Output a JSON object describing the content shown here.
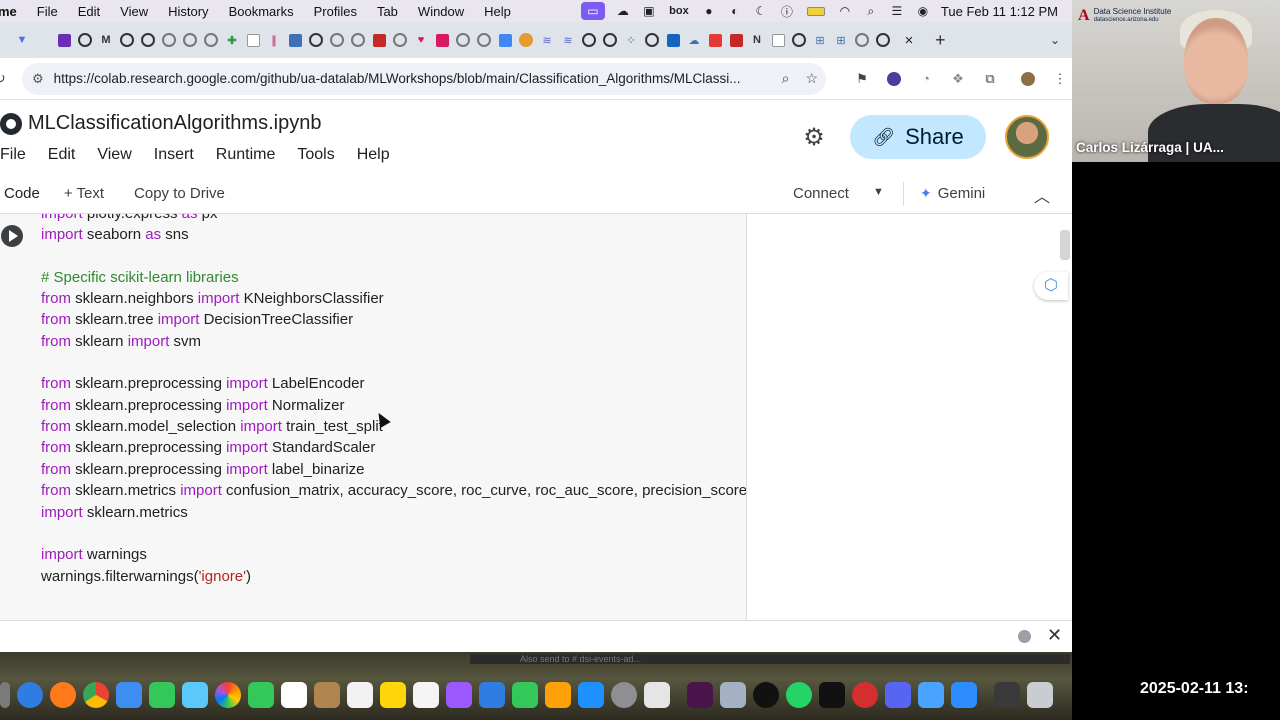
{
  "menubar": {
    "items": [
      "me",
      "File",
      "Edit",
      "View",
      "History",
      "Bookmarks",
      "Profiles",
      "Tab",
      "Window",
      "Help"
    ],
    "clock": "Tue Feb 11  1:12 PM"
  },
  "tabs": {
    "close": "×",
    "new": "+",
    "menu": "⌄"
  },
  "address": {
    "url": "https://colab.research.google.com/github/ua-datalab/MLWorkshops/blob/main/Classification_Algorithms/MLClassi..."
  },
  "colab": {
    "title": "MLClassificationAlgorithms.ipynb",
    "menu": [
      "File",
      "Edit",
      "View",
      "Insert",
      "Runtime",
      "Tools",
      "Help"
    ],
    "share_label": "Share"
  },
  "toolbar": {
    "code": "Code",
    "text": "+ Text",
    "copy": "Copy to Drive",
    "connect": "Connect",
    "gemini": "Gemini"
  },
  "code_lines": [
    {
      "kw1": "import",
      "mid": " plotly.express ",
      "kw2": "as",
      "tail": " px"
    },
    {
      "kw1": "import",
      "mid": " seaborn ",
      "kw2": "as",
      "tail": " sns"
    },
    {
      "comment": "# Specific scikit-learn libraries"
    },
    {
      "kw1": "from",
      "mid": " sklearn.neighbors ",
      "kw2": "import",
      "tail": " KNeighborsClassifier"
    },
    {
      "kw1": "from",
      "mid": " sklearn.tree ",
      "kw2": "import",
      "tail": " DecisionTreeClassifier"
    },
    {
      "kw1": "from",
      "mid": " sklearn ",
      "kw2": "import",
      "tail": " svm"
    },
    {
      "kw1": "from",
      "mid": " sklearn.preprocessing ",
      "kw2": "import",
      "tail": " LabelEncoder"
    },
    {
      "kw1": "from",
      "mid": " sklearn.preprocessing ",
      "kw2": "import",
      "tail": " Normalizer"
    },
    {
      "kw1": "from",
      "mid": " sklearn.model_selection ",
      "kw2": "import",
      "tail": " train_test_split"
    },
    {
      "kw1": "from",
      "mid": " sklearn.preprocessing ",
      "kw2": "import",
      "tail": " StandardScaler"
    },
    {
      "kw1": "from",
      "mid": " sklearn.preprocessing ",
      "kw2": "import",
      "tail": " label_binarize"
    },
    {
      "kw1": "from",
      "mid": " sklearn.metrics ",
      "kw2": "import",
      "tail": " confusion_matrix, accuracy_score, roc_curve, roc_auc_score, precision_score"
    },
    {
      "kw1": "import",
      "mid": " sklearn.metrics",
      "kw2": "",
      "tail": ""
    },
    {
      "kw1": "import",
      "mid": " warnings",
      "kw2": "",
      "tail": ""
    },
    {
      "plain": "warnings.filterwarnings(",
      "string": "'ignore'",
      "close": ")"
    }
  ],
  "dock_strip_text": "Also send to # dsi-events-ad...",
  "video": {
    "institute_line1": "Data Science Institute",
    "institute_line2": "datascience.arizona.edu",
    "participant": "Carlos Lizárraga | UA..."
  },
  "timestamp": "2025-02-11  13:"
}
